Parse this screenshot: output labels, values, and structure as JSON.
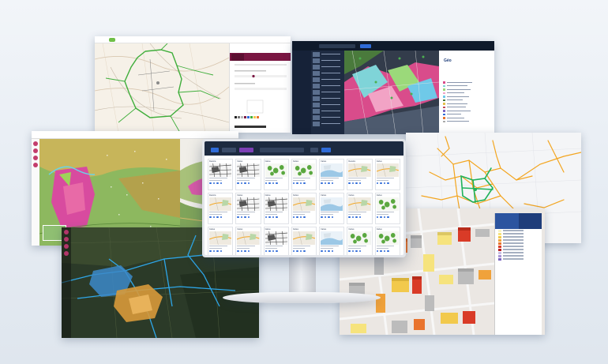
{
  "scene": {
    "description_colors": {
      "background": "#eaeff5",
      "brand_maroon": "#7a1642",
      "brand_navy": "#1c2a40",
      "accent_blue": "#2f6bd8",
      "network_orange": "#f3a51f",
      "network_green": "#1fb25a"
    }
  },
  "screens": {
    "topo_app": {
      "menu": [
        "",
        "",
        "",
        "",
        "",
        "",
        "",
        ""
      ]
    },
    "dark_gis_app": {
      "brand": "Géo",
      "legend_tabs": [
        "",
        "",
        ""
      ]
    },
    "monitor_app": {
      "cards": [
        {
          "category": "Dessins",
          "thumb": "sketch"
        },
        {
          "category": "Cartes",
          "thumb": "sketch"
        },
        {
          "category": "Cartes",
          "thumb": "green"
        },
        {
          "category": "Cartes",
          "thumb": "green"
        },
        {
          "category": "Cartes",
          "thumb": "blue"
        },
        {
          "category": "Dessins",
          "thumb": "map"
        },
        {
          "category": "Cartes",
          "thumb": "map"
        },
        {
          "category": "Dessins",
          "thumb": "map"
        },
        {
          "category": "Cartes",
          "thumb": "sketch"
        },
        {
          "category": "Cartes",
          "thumb": "sketch"
        },
        {
          "category": "Cartes",
          "thumb": "map"
        },
        {
          "category": "Cartes",
          "thumb": "blue"
        },
        {
          "category": "Cartes",
          "thumb": "map"
        },
        {
          "category": "Cartes",
          "thumb": "green"
        },
        {
          "category": "Cartes",
          "thumb": "map"
        },
        {
          "category": "Cartes",
          "thumb": "map"
        },
        {
          "category": "Cartes",
          "thumb": "sketch"
        },
        {
          "category": "Cartes",
          "thumb": "map"
        },
        {
          "category": "Cartes",
          "thumb": "blue"
        },
        {
          "category": "Cartes",
          "thumb": "green"
        },
        {
          "category": "Cartes",
          "thumb": "green"
        }
      ]
    },
    "city_3d_app": {
      "swatches": [
        "#f7f3c4",
        "#f6e37d",
        "#f2c94c",
        "#f0a23b",
        "#e9742e",
        "#d93b27",
        "#b51f24",
        "#c8bde3",
        "#a995d6",
        "#7c67c2"
      ]
    }
  }
}
